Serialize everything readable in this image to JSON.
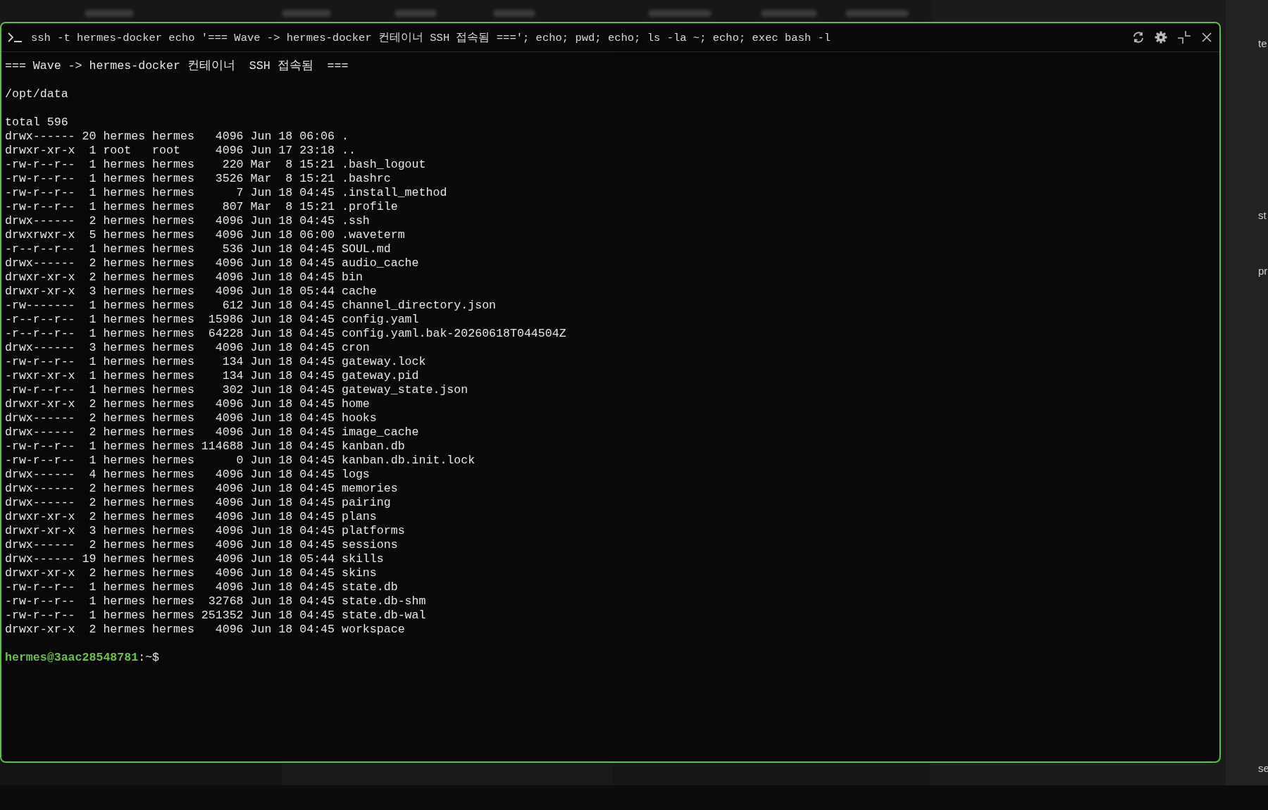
{
  "terminal": {
    "command": "ssh -t hermes-docker echo '=== Wave -> hermes-docker 컨테이너 SSH 접속됨 ==='; echo; pwd; echo; ls -la ~; echo; exec bash -l",
    "banner": "=== Wave -> hermes-docker 컨테이너  SSH 접속됨  ===",
    "cwd": "/opt/data",
    "total": "total 596",
    "rows": [
      "drwx------ 20 hermes hermes   4096 Jun 18 06:06 .",
      "drwxr-xr-x  1 root   root     4096 Jun 17 23:18 ..",
      "-rw-r--r--  1 hermes hermes    220 Mar  8 15:21 .bash_logout",
      "-rw-r--r--  1 hermes hermes   3526 Mar  8 15:21 .bashrc",
      "-rw-r--r--  1 hermes hermes      7 Jun 18 04:45 .install_method",
      "-rw-r--r--  1 hermes hermes    807 Mar  8 15:21 .profile",
      "drwx------  2 hermes hermes   4096 Jun 18 04:45 .ssh",
      "drwxrwxr-x  5 hermes hermes   4096 Jun 18 06:00 .waveterm",
      "-r--r--r--  1 hermes hermes    536 Jun 18 04:45 SOUL.md",
      "drwx------  2 hermes hermes   4096 Jun 18 04:45 audio_cache",
      "drwxr-xr-x  2 hermes hermes   4096 Jun 18 04:45 bin",
      "drwxr-xr-x  3 hermes hermes   4096 Jun 18 05:44 cache",
      "-rw-------  1 hermes hermes    612 Jun 18 04:45 channel_directory.json",
      "-r--r--r--  1 hermes hermes  15986 Jun 18 04:45 config.yaml",
      "-r--r--r--  1 hermes hermes  64228 Jun 18 04:45 config.yaml.bak-20260618T044504Z",
      "drwx------  3 hermes hermes   4096 Jun 18 04:45 cron",
      "-rw-r--r--  1 hermes hermes    134 Jun 18 04:45 gateway.lock",
      "-rwxr-xr-x  1 hermes hermes    134 Jun 18 04:45 gateway.pid",
      "-rw-r--r--  1 hermes hermes    302 Jun 18 04:45 gateway_state.json",
      "drwxr-xr-x  2 hermes hermes   4096 Jun 18 04:45 home",
      "drwx------  2 hermes hermes   4096 Jun 18 04:45 hooks",
      "drwx------  2 hermes hermes   4096 Jun 18 04:45 image_cache",
      "-rw-r--r--  1 hermes hermes 114688 Jun 18 04:45 kanban.db",
      "-rw-r--r--  1 hermes hermes      0 Jun 18 04:45 kanban.db.init.lock",
      "drwx------  4 hermes hermes   4096 Jun 18 04:45 logs",
      "drwx------  2 hermes hermes   4096 Jun 18 04:45 memories",
      "drwx------  2 hermes hermes   4096 Jun 18 04:45 pairing",
      "drwxr-xr-x  2 hermes hermes   4096 Jun 18 04:45 plans",
      "drwxr-xr-x  3 hermes hermes   4096 Jun 18 04:45 platforms",
      "drwx------  2 hermes hermes   4096 Jun 18 04:45 sessions",
      "drwx------ 19 hermes hermes   4096 Jun 18 05:44 skills",
      "drwxr-xr-x  2 hermes hermes   4096 Jun 18 04:45 skins",
      "-rw-r--r--  1 hermes hermes   4096 Jun 18 04:45 state.db",
      "-rw-r--r--  1 hermes hermes  32768 Jun 18 04:45 state.db-shm",
      "-rw-r--r--  1 hermes hermes 251352 Jun 18 04:45 state.db-wal",
      "drwxr-xr-x  2 hermes hermes   4096 Jun 18 04:45 workspace"
    ],
    "prompt": {
      "user_host": "hermes@3aac28548781",
      "suffix": ":~$"
    }
  },
  "side_panel": {
    "fragments": [
      "te",
      "st",
      "pr",
      "se"
    ]
  }
}
